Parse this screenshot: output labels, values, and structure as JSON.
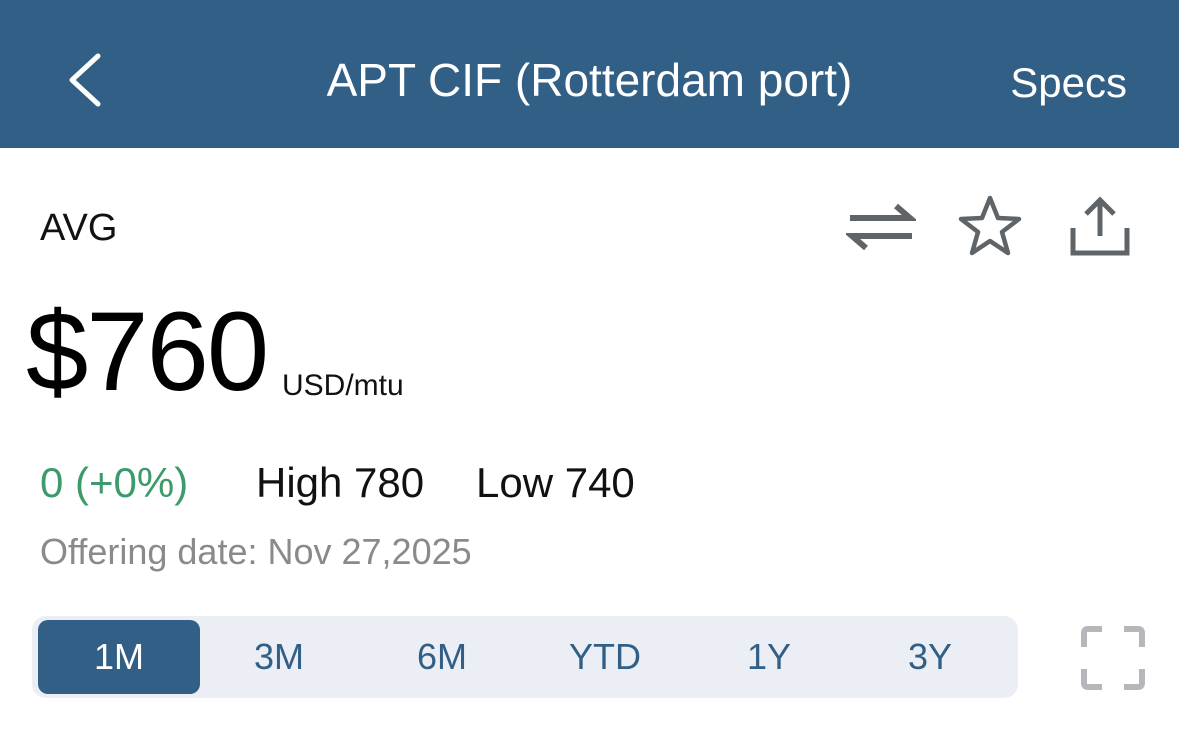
{
  "header": {
    "title": "APT CIF (Rotterdam port)",
    "specs_label": "Specs",
    "back_icon": "chevron-left-icon",
    "background": "#325f86"
  },
  "quote": {
    "label": "AVG",
    "price": "$760",
    "unit": "USD/mtu",
    "change": "0 (+0%)",
    "change_color": "#3d9a6a",
    "high": "High 780",
    "low": "Low 740",
    "offering_date": "Offering date: Nov 27,2025"
  },
  "actions": {
    "icons": [
      "swap-icon",
      "star-icon",
      "share-icon"
    ]
  },
  "ranges": {
    "tabs": [
      "1M",
      "3M",
      "6M",
      "YTD",
      "1Y",
      "3Y"
    ],
    "selected": "1M",
    "fullscreen_icon": "fullscreen-icon"
  }
}
